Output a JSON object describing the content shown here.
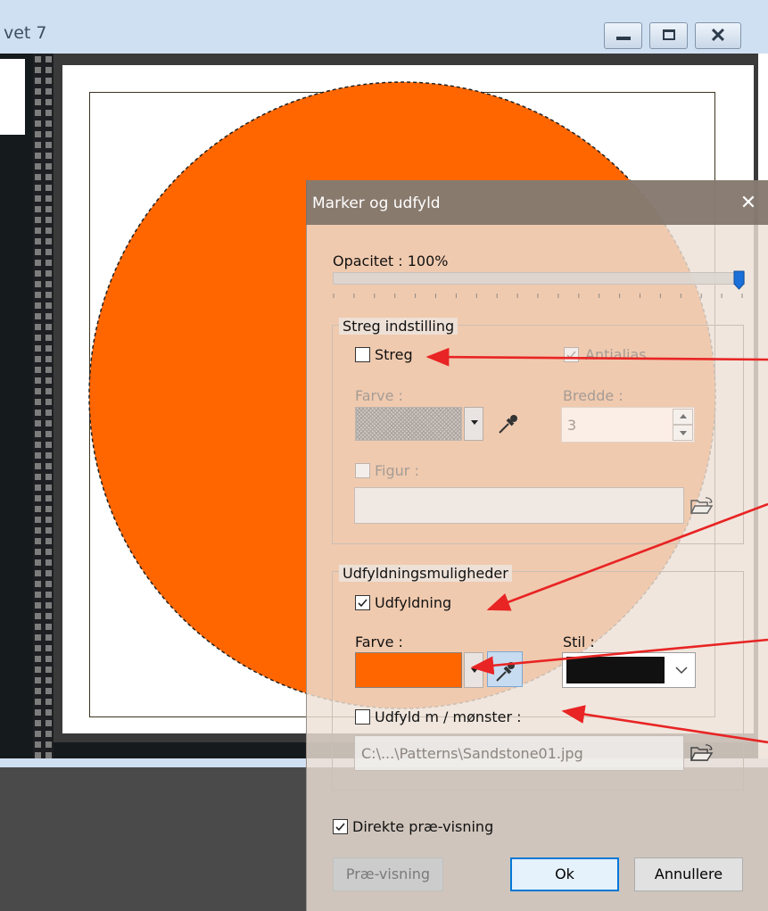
{
  "window": {
    "title": "vet 7",
    "minimize_label": "minimize",
    "maximize_label": "maximize",
    "close_label": "close"
  },
  "canvas": {
    "circle_color": "#ff6600"
  },
  "dialog": {
    "title": "Marker og udfyld",
    "close": "✕",
    "opacity_label": "Opacitet : 100%",
    "opacity_value": 1.0,
    "stroke_group": {
      "title": "Streg indstilling",
      "stroke_label": "Streg",
      "stroke_checked": false,
      "antialias_label": "Antialias",
      "antialias_checked": true,
      "color_label": "Farve :",
      "width_label": "Bredde :",
      "width_value": "3",
      "shape_label": "Figur :",
      "shape_checked": false,
      "shape_path": ""
    },
    "fill_group": {
      "title": "Udfyldningsmuligheder",
      "fill_label": "Udfyldning",
      "fill_checked": true,
      "color_label": "Farve :",
      "fill_color": "#ff6600",
      "style_label": "Stil :",
      "style_color": "#111111",
      "pattern_label": "Udfyld m / mønster :",
      "pattern_checked": false,
      "pattern_path": "C:\\...\\Patterns\\Sandstone01.jpg"
    },
    "live_preview_label": "Direkte præ-visning",
    "live_preview_checked": true,
    "preview_button": "Præ-visning",
    "ok_button": "Ok",
    "cancel_button": "Annullere"
  },
  "annotation_color": "#e82424"
}
